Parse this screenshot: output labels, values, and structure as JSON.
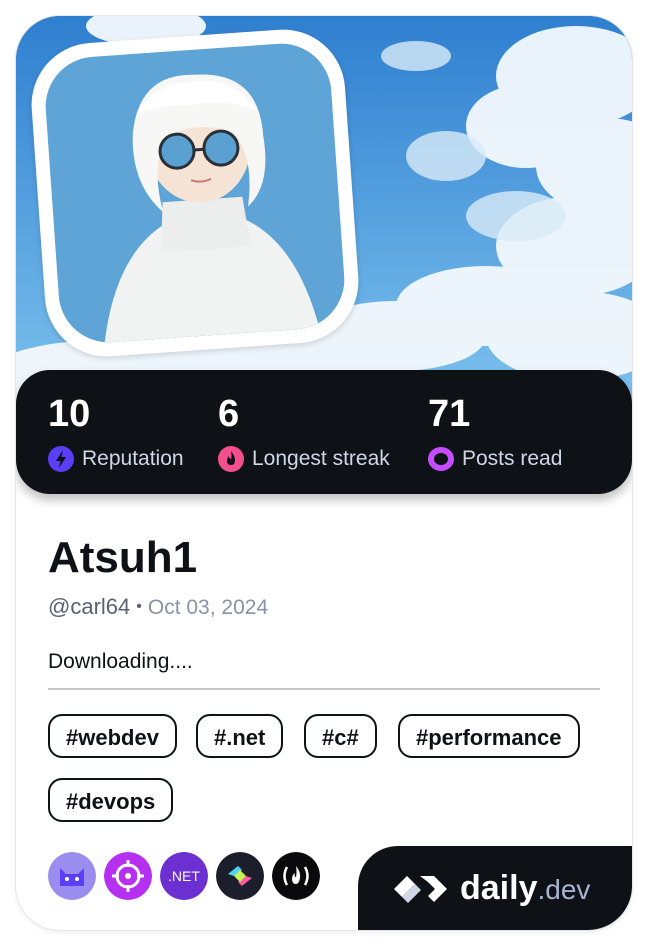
{
  "profile": {
    "name": "Atsuh1",
    "handle": "@carl64",
    "joined": "Oct 03, 2024",
    "bio": "Downloading...."
  },
  "stats": [
    {
      "value": "10",
      "label": "Reputation",
      "icon": "bolt-icon",
      "color": "#5b3ff7"
    },
    {
      "value": "6",
      "label": "Longest streak",
      "icon": "flame-icon",
      "color": "#f24f8f"
    },
    {
      "value": "71",
      "label": "Posts read",
      "icon": "eye-ring-icon",
      "color": "#c44dff"
    }
  ],
  "tags": [
    "#webdev",
    "#.net",
    "#c#",
    "#performance",
    "#devops"
  ],
  "sources": [
    {
      "name": "cat-source-icon",
      "color": "#9b8cf0"
    },
    {
      "name": "target-source-icon",
      "color": "#b530f0"
    },
    {
      "name": "dotnet-source-icon",
      "label": ".NET",
      "color": "#6b2fd2"
    },
    {
      "name": "dev-tools-source-icon",
      "color": "#1c1f2b"
    },
    {
      "name": "freecodecamp-source-icon",
      "color": "#0a0a0c"
    }
  ],
  "brand": {
    "name": "daily",
    "suffix": ".dev"
  },
  "colors": {
    "dark": "#0e1217",
    "sky": "#5aa9e6"
  }
}
